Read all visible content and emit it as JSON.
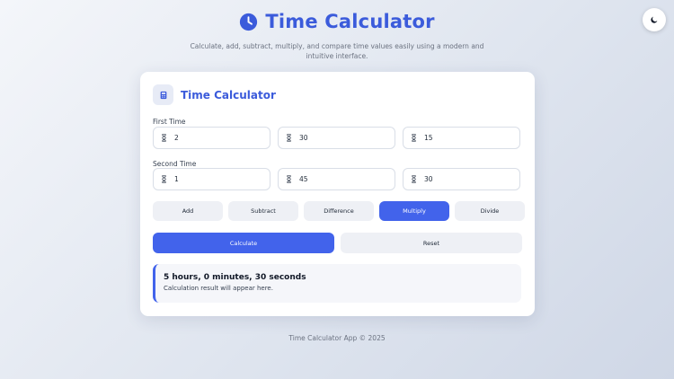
{
  "header": {
    "title": "Time Calculator",
    "subtitle": "Calculate, add, subtract, multiply, and compare time values easily using a modern and intuitive interface.",
    "icon": "clock-icon"
  },
  "theme_toggle": {
    "icon": "moon-icon"
  },
  "card": {
    "title": "Time Calculator",
    "icon": "calculator-icon",
    "first_time": {
      "label": "First Time",
      "hours": "2",
      "minutes": "30",
      "seconds": "15"
    },
    "second_time": {
      "label": "Second Time",
      "hours": "1",
      "minutes": "45",
      "seconds": "30"
    },
    "input_icon": "hourglass-icon",
    "operations": [
      "Add",
      "Subtract",
      "Difference",
      "Multiply",
      "Divide"
    ],
    "active_operation": "Multiply",
    "calculate_label": "Calculate",
    "reset_label": "Reset",
    "result": {
      "main": "5 hours, 0 minutes, 30 seconds",
      "sub": "Calculation result will appear here."
    }
  },
  "footer": {
    "text": "Time Calculator App © 2025"
  },
  "colors": {
    "accent": "#4263eb",
    "title": "#3b5bdb",
    "button_bg": "#eef0f5"
  }
}
